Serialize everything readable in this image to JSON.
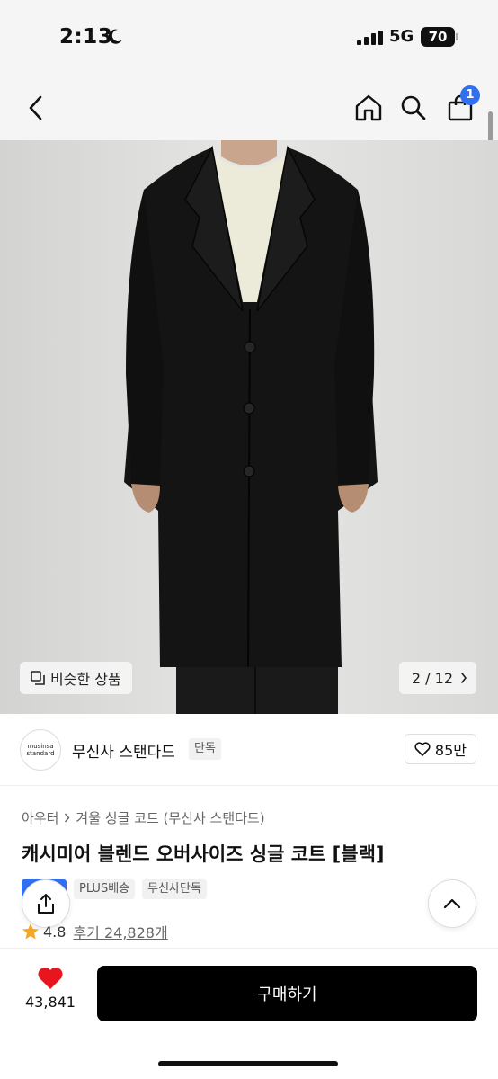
{
  "status": {
    "time": "2:13",
    "network": "5G",
    "battery": "70"
  },
  "nav": {
    "cart_count": "1"
  },
  "image": {
    "similar_label": "비슷한 상품",
    "counter": "2 / 12"
  },
  "brand": {
    "logo_line1": "musinsa",
    "logo_line2": "standard",
    "name": "무신사 스탠다드",
    "exclusive": "단독",
    "likes": "85만"
  },
  "breadcrumb": {
    "category": "아우터",
    "subcategory": "겨울 싱글 코트 (무신사 스탠다드)"
  },
  "product": {
    "title": "캐시미어 블렌드 오버사이즈 싱글 코트 [블랙]",
    "badges": [
      "PLUS배송",
      "무신사단독"
    ],
    "rating": "4.8",
    "reviews": "후기 24,828개"
  },
  "bottom": {
    "like_count": "43,841",
    "buy_label": "구매하기"
  },
  "colors": {
    "accent_blue": "#2f6ff0",
    "heart_red": "#e8151f",
    "star_orange": "#f5a623"
  }
}
